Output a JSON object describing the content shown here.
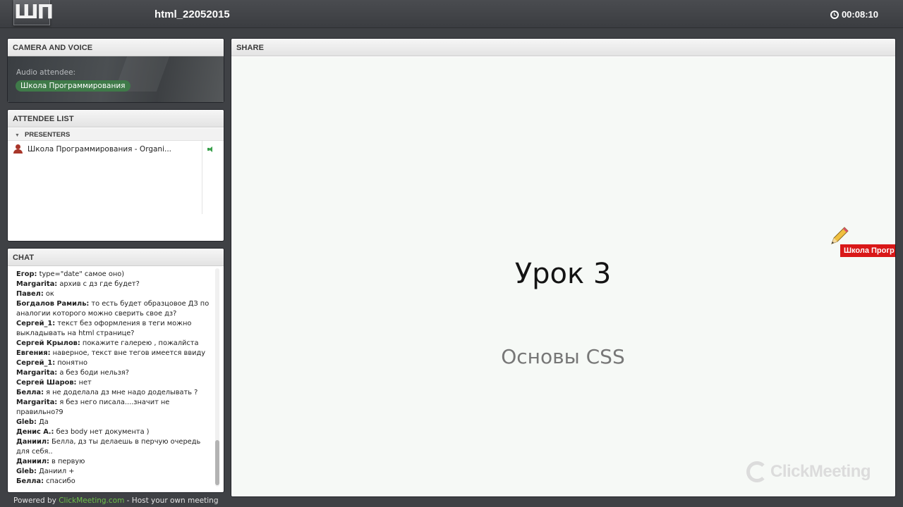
{
  "header": {
    "logo_text": "ШП",
    "title": "html_22052015",
    "timer": "00:08:10"
  },
  "camera": {
    "title": "CAMERA AND VOICE",
    "audio_label": "Audio attendee:",
    "audio_name": "Школа Программирования"
  },
  "attendees": {
    "title": "ATTENDEE LIST",
    "group": "PRESENTERS",
    "items": [
      {
        "name": "Школа Программирования - Organi..."
      }
    ]
  },
  "chat": {
    "title": "CHAT",
    "messages": [
      {
        "author": "Егор:",
        "text": " type=\"date\" самое оно)"
      },
      {
        "author": "Margarita:",
        "text": " архив с дз где будет?"
      },
      {
        "author": "Павел:",
        "text": " ок"
      },
      {
        "author": "Богдалов Рамиль:",
        "text": " то есть будет образцовое ДЗ по"
      },
      {
        "author": "",
        "text": "аналогии которого можно сверить свое дз?"
      },
      {
        "author": "Сергей_1:",
        "text": " текст без оформления в теги можно"
      },
      {
        "author": "",
        "text": "выкладывать на html странице?"
      },
      {
        "author": "Сергей Крылов:",
        "text": " покажите галерею , пожалйста"
      },
      {
        "author": "Евгения:",
        "text": " наверное, текст вне тегов имеется ввиду"
      },
      {
        "author": "Сергей_1:",
        "text": " понятно"
      },
      {
        "author": "Margarita:",
        "text": " а без боди нельзя?"
      },
      {
        "author": "Сергей Шаров:",
        "text": " нет"
      },
      {
        "author": "Белла:",
        "text": " я не доделала дз мне надо доделывать ?"
      },
      {
        "author": "Margarita:",
        "text": " я без него писала....значит не"
      },
      {
        "author": "",
        "text": "правильно?9"
      },
      {
        "author": "Gleb:",
        "text": " Да"
      },
      {
        "author": "Денис А.:",
        "text": " без body нет документа )"
      },
      {
        "author": "Даниил:",
        "text": " Белла, дз ты делаешь в перчую очередь"
      },
      {
        "author": "",
        "text": "для себя.."
      },
      {
        "author": "Даниил:",
        "text": " в первую"
      },
      {
        "author": "Gleb:",
        "text": " Даниил +"
      },
      {
        "author": "Белла:",
        "text": " спасибо"
      }
    ]
  },
  "share": {
    "title": "SHARE",
    "slide_title": "Урок 3",
    "slide_subtitle": "Основы CSS",
    "presenter_tag": "Школа Прогр",
    "watermark": "ClickMeeting"
  },
  "footer": {
    "prefix": "Powered by ",
    "link": "ClickMeeting.com",
    "suffix": " - Host your own meeting"
  },
  "icons": {
    "timer": "clock-icon",
    "attendee": "person-icon",
    "audio": "speaker-icon",
    "annotation": "pencil-icon"
  },
  "colors": {
    "audio_pill": "#3f7a49",
    "presenter_tag": "#d91818",
    "link": "#6ec04a"
  }
}
